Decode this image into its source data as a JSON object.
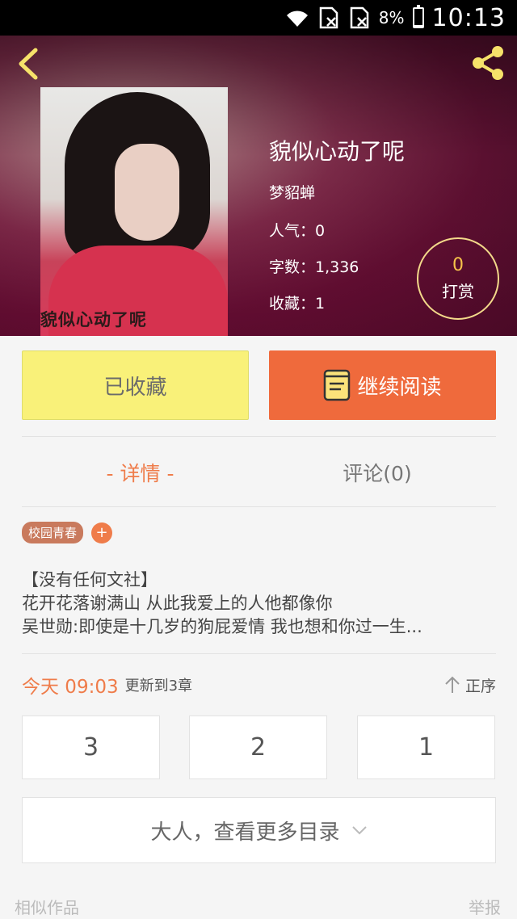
{
  "status_bar": {
    "battery_percent": "8%",
    "time": "10:13",
    "icons": [
      "wifi-icon",
      "sim-off-icon",
      "sim-off-icon",
      "battery-icon"
    ]
  },
  "header": {
    "back_icon": "chevron-left-icon",
    "share_icon": "share-icon"
  },
  "book": {
    "cover_caption": "貌似心动了呢",
    "title": "貌似心动了呢",
    "author": "梦貂蝉",
    "popularity": "人气：0",
    "word_count": "字数：1,336",
    "favorites": "收藏：1",
    "reward_count": "0",
    "reward_label": "打赏"
  },
  "actions": {
    "collect_label": "已收藏",
    "read_label": "继续阅读"
  },
  "tabs": [
    {
      "label": "- 详情 -",
      "active": true
    },
    {
      "label": "评论(0)",
      "active": false
    }
  ],
  "tags": [
    "校园青春"
  ],
  "tag_add": "+",
  "synopsis": [
    "【没有任何文社】",
    "花开花落谢满山 从此我爱上的人他都像你",
    "吴世勋:即使是十几岁的狗屁爱情 我也想和你过一生..."
  ],
  "update": {
    "time": "今天 09:03",
    "label": "更新到3章",
    "sort_label": "正序"
  },
  "chapters": [
    "3",
    "2",
    "1"
  ],
  "more_catalog": "大人，查看更多目录",
  "footer": {
    "similar": "相似作品",
    "report": "举报"
  },
  "colors": {
    "accent": "#ef6a3c",
    "collect_bg": "#f9f179",
    "reward_gold": "#f6c24a"
  }
}
